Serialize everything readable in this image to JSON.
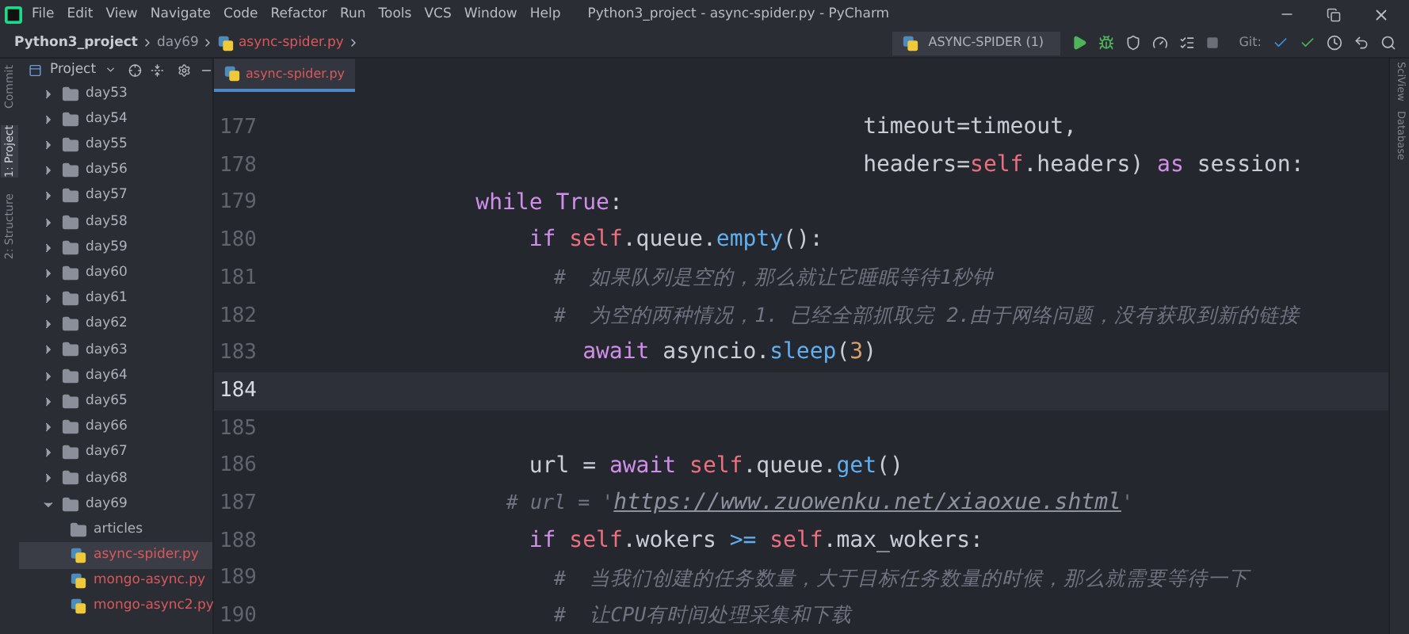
{
  "window": {
    "title": "Python3_project - async-spider.py - PyCharm"
  },
  "menu": [
    "File",
    "Edit",
    "View",
    "Navigate",
    "Code",
    "Refactor",
    "Run",
    "Tools",
    "VCS",
    "Window",
    "Help"
  ],
  "breadcrumb": [
    {
      "label": "Python3_project",
      "kind": "project"
    },
    {
      "label": "day69",
      "kind": "folder"
    },
    {
      "label": "async-spider.py",
      "kind": "python"
    }
  ],
  "toolbar": {
    "run_config": "ASYNC-SPIDER (1)",
    "vcs_label": "Git:"
  },
  "left_strip": [
    {
      "label": "Commit",
      "selected": false
    },
    {
      "label": "1: Project",
      "selected": true
    },
    {
      "label": "2: Structure",
      "selected": false
    }
  ],
  "right_strip": [
    "SciView",
    "Database"
  ],
  "project_panel": {
    "title": "Project",
    "tree": [
      {
        "label": "day53",
        "kind": "folder",
        "expanded": false
      },
      {
        "label": "day54",
        "kind": "folder",
        "expanded": false
      },
      {
        "label": "day55",
        "kind": "folder",
        "expanded": false
      },
      {
        "label": "day56",
        "kind": "folder",
        "expanded": false
      },
      {
        "label": "day57",
        "kind": "folder",
        "expanded": false
      },
      {
        "label": "day58",
        "kind": "folder",
        "expanded": false
      },
      {
        "label": "day59",
        "kind": "folder",
        "expanded": false
      },
      {
        "label": "day60",
        "kind": "folder",
        "expanded": false
      },
      {
        "label": "day61",
        "kind": "folder",
        "expanded": false
      },
      {
        "label": "day62",
        "kind": "folder",
        "expanded": false
      },
      {
        "label": "day63",
        "kind": "folder",
        "expanded": false
      },
      {
        "label": "day64",
        "kind": "folder",
        "expanded": false
      },
      {
        "label": "day65",
        "kind": "folder",
        "expanded": false
      },
      {
        "label": "day66",
        "kind": "folder",
        "expanded": false
      },
      {
        "label": "day67",
        "kind": "folder",
        "expanded": false
      },
      {
        "label": "day68",
        "kind": "folder",
        "expanded": false
      },
      {
        "label": "day69",
        "kind": "folder",
        "expanded": true,
        "children": [
          {
            "label": "articles",
            "kind": "plainfolder",
            "selected": false,
            "untracked": false
          },
          {
            "label": "async-spider.py",
            "kind": "python",
            "selected": true,
            "untracked": true
          },
          {
            "label": "mongo-async.py",
            "kind": "python",
            "selected": false,
            "untracked": true
          },
          {
            "label": "mongo-async2.py",
            "kind": "python",
            "selected": false,
            "untracked": true
          }
        ]
      }
    ]
  },
  "editor": {
    "tab": {
      "label": "async-spider.py",
      "untracked": true
    },
    "lines": [
      {
        "number": "177",
        "current": false,
        "tokens": [
          {
            "kind": "plain",
            "text": "                                         timeout=timeout,"
          }
        ]
      },
      {
        "number": "178",
        "current": false,
        "tokens": [
          {
            "kind": "plain",
            "text": "                                         headers="
          },
          {
            "kind": "self",
            "text": "self"
          },
          {
            "kind": "plain",
            "text": ".headers) "
          },
          {
            "kind": "keyword",
            "text": "as"
          },
          {
            "kind": "plain",
            "text": " session:"
          }
        ]
      },
      {
        "number": "179",
        "current": false,
        "tokens": [
          {
            "kind": "keyword",
            "text": "            while True"
          },
          {
            "kind": "plain",
            "text": ":"
          }
        ]
      },
      {
        "number": "180",
        "current": false,
        "tokens": [
          {
            "kind": "keyword",
            "text": "                if "
          },
          {
            "kind": "self",
            "text": "self"
          },
          {
            "kind": "plain",
            "text": ".queue."
          },
          {
            "kind": "func",
            "text": "empty"
          },
          {
            "kind": "plain",
            "text": "():"
          }
        ]
      },
      {
        "number": "181",
        "current": false,
        "tokens": [
          {
            "kind": "comment",
            "text": "                    #  如果队列是空的，那么就让它睡眠等待1秒钟"
          }
        ]
      },
      {
        "number": "182",
        "current": false,
        "tokens": [
          {
            "kind": "comment",
            "text": "                    #  为空的两种情况，1. 已经全部抓取完 2.由于网络问题，没有获取到新的链接"
          }
        ]
      },
      {
        "number": "183",
        "current": false,
        "tokens": [
          {
            "kind": "keyword",
            "text": "                    await"
          },
          {
            "kind": "plain",
            "text": " asyncio."
          },
          {
            "kind": "func",
            "text": "sleep"
          },
          {
            "kind": "plain",
            "text": "("
          },
          {
            "kind": "number",
            "text": "3"
          },
          {
            "kind": "plain",
            "text": ")"
          }
        ]
      },
      {
        "number": "184",
        "current": true
      },
      {
        "number": "185",
        "current": false
      },
      {
        "number": "186",
        "current": false,
        "tokens": [
          {
            "kind": "plain",
            "text": "                url = "
          },
          {
            "kind": "keyword",
            "text": "await "
          },
          {
            "kind": "self",
            "text": "self"
          },
          {
            "kind": "plain",
            "text": ".queue."
          },
          {
            "kind": "func",
            "text": "get"
          },
          {
            "kind": "plain",
            "text": "()"
          }
        ]
      },
      {
        "number": "187",
        "current": false,
        "tokens": [
          {
            "kind": "comment",
            "text": "                # url = '"
          },
          {
            "kind": "link",
            "text": "https://www.zuowenku.net/xiaoxue.shtml"
          },
          {
            "kind": "comment",
            "text": "'"
          }
        ]
      },
      {
        "number": "188",
        "current": false,
        "tokens": [
          {
            "kind": "keyword",
            "text": "                if "
          },
          {
            "kind": "self",
            "text": "self"
          },
          {
            "kind": "plain",
            "text": ".wokers "
          },
          {
            "kind": "operator",
            "text": ">= "
          },
          {
            "kind": "self",
            "text": "self"
          },
          {
            "kind": "plain",
            "text": ".max_wokers:"
          }
        ]
      },
      {
        "number": "189",
        "current": false,
        "tokens": [
          {
            "kind": "comment",
            "text": "                    #  当我们创建的任务数量，大于目标任务数量的时候，那么就需要等待一下"
          }
        ]
      },
      {
        "number": "190",
        "current": false,
        "tokens": [
          {
            "kind": "comment",
            "text": "                    #  让CPU有时间处理采集和下载"
          }
        ]
      }
    ]
  }
}
